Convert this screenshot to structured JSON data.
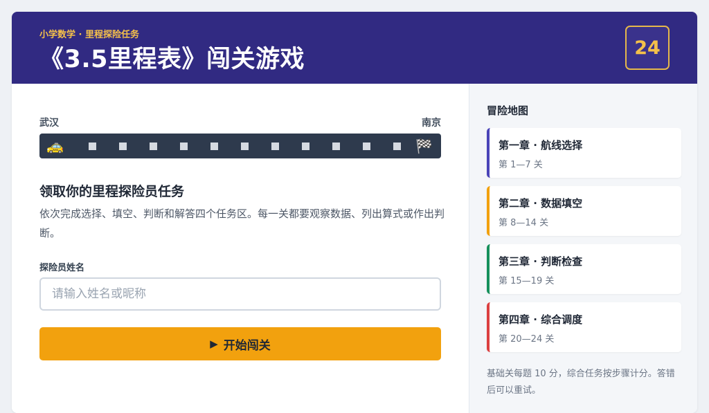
{
  "header": {
    "subtitle": "小学数学 · 里程探险任务",
    "title": "《3.5里程表》闯关游戏",
    "level_count": "24"
  },
  "route": {
    "start_city": "武汉",
    "end_city": "南京",
    "car_icon": "taxi-icon",
    "finish_icon": "checkered-flag-icon",
    "stop_count": 11
  },
  "task": {
    "title": "领取你的里程探险员任务",
    "description": "依次完成选择、填空、判断和解答四个任务区。每一关都要观察数据、列出算式或作出判断。"
  },
  "form": {
    "name_label": "探险员姓名",
    "name_placeholder": "请输入姓名或昵称",
    "name_value": "",
    "start_button_icon": "▶",
    "start_button_label": "开始闯关"
  },
  "sidebar": {
    "title": "冒险地图",
    "chapters": [
      {
        "name": "第一章 · 航线选择",
        "range": "第 1—7 关",
        "color": "#4a44b8"
      },
      {
        "name": "第二章 · 数据填空",
        "range": "第 8—14 关",
        "color": "#f2a10e"
      },
      {
        "name": "第三章 · 判断检查",
        "range": "第 15—19 关",
        "color": "#17915c"
      },
      {
        "name": "第四章 · 综合调度",
        "range": "第 20—24 关",
        "color": "#dc4040"
      }
    ],
    "note": "基础关每题 10 分，综合任务按步骤计分。答错后可以重试。"
  },
  "colors": {
    "header_bg": "#312a82",
    "accent_gold": "#f4c04a",
    "button_orange": "#f2a10e",
    "track_bg": "#2e3a4d"
  }
}
